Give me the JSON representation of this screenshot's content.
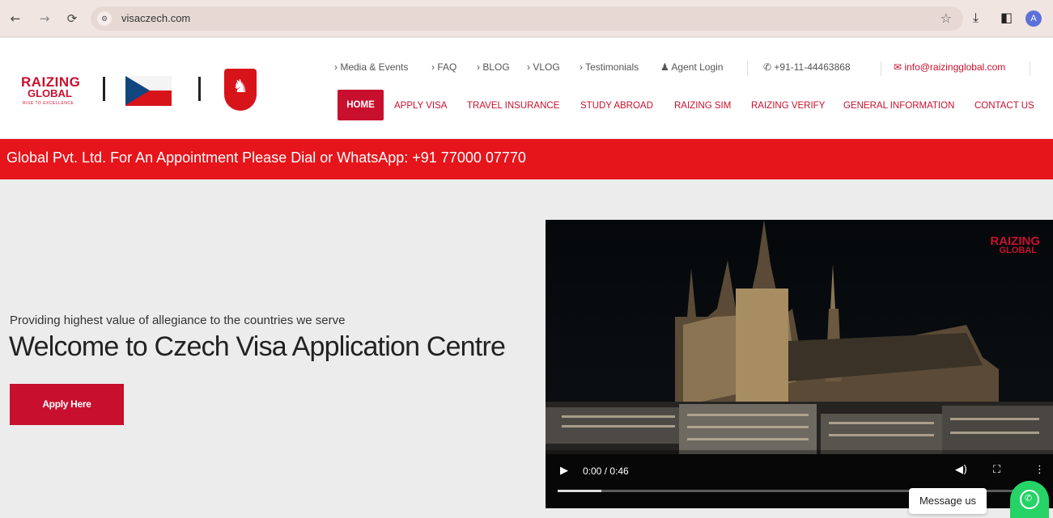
{
  "browser": {
    "url": "visaczech.com",
    "icons": {
      "back": "←",
      "forward": "→",
      "reload": "⟳",
      "site": "⚙",
      "star": "☆",
      "download": "⤓",
      "sidepanel": "◧"
    },
    "avatar_letter": "A"
  },
  "brand": {
    "logo_line1": "RAIZING",
    "logo_line2": "GLOBAL",
    "logo_tag": "RISE TO EXCELLENCE",
    "color": "#c8102e"
  },
  "topnav": {
    "items": [
      "› Media & Events",
      "› FAQ",
      "› BLOG",
      "› VLOG",
      "› Testimonials"
    ],
    "agent_login": "♟ Agent Login",
    "phone": "✆ +91-11-44463868",
    "email": "✉ info@raizingglobal.com"
  },
  "menu": {
    "home": "HOME",
    "items": [
      "APPLY VISA",
      "TRAVEL INSURANCE",
      "STUDY ABROAD",
      "RAIZING SIM",
      "RAIZING VERIFY",
      "GENERAL INFORMATION",
      "CONTACT US"
    ]
  },
  "marquee": {
    "text": "Global Pvt. Ltd. For An Appointment Please Dial or WhatsApp: +91 77000 07770"
  },
  "hero": {
    "tagline": "Providing highest value of allegiance to the countries we serve",
    "title": "Welcome to Czech Visa Application Centre",
    "apply_label": "Apply Here"
  },
  "video": {
    "logo_line1": "RAIZING",
    "logo_line2": "GLOBAL",
    "time": "0:00 / 0:46",
    "progress": 0.09,
    "icons": {
      "play": "▶",
      "volume": "🔊",
      "fullscreen": "⛶",
      "more": "⋮"
    }
  },
  "chat": {
    "label": "Message us",
    "icon": "whatsapp-icon"
  }
}
